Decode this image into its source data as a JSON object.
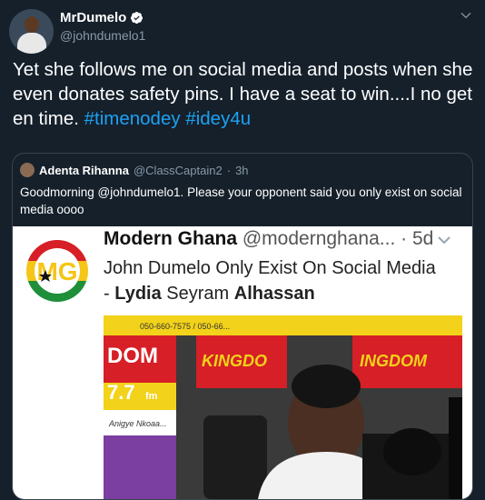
{
  "tweet": {
    "author_name": "MrDumelo",
    "author_handle": "@johndumelo1",
    "text_main": "Yet she follows me on social media and posts when she even donates safety pins. I have a seat to win....I no get en time.",
    "hashtags": [
      "#timenodey",
      "#idey4u"
    ],
    "icons": {
      "verified": "verified-badge-icon",
      "menu": "chevron-down-icon"
    }
  },
  "quote": {
    "author_name": "Adenta Rihanna",
    "author_handle": "@ClassCaptain2",
    "separator": "·",
    "time": "3h",
    "text": "Goodmorning @johndumelo1. Please your opponent said you only exist on social media oooo",
    "image": {
      "logo_text": "MG",
      "account_name": "Modern Ghana",
      "account_handle": "@modernghana...",
      "separator": "·",
      "time": "5d",
      "headline_main": "John Dumelo Only Exist On Social Media",
      "headline_prefix": "- ",
      "headline_name_first": "Lydia",
      "headline_name_mid": " Seyram ",
      "headline_name_last": "Alhassan",
      "banner_phone": "050-660-7575 / 050-66...",
      "banner_left_brand": "DOM",
      "banner_left_freq": "7.7",
      "banner_left_fm": "fm",
      "banner_center_brand": "KINGDO",
      "banner_right_brand": "INGDOM",
      "sign_text": "Anigye Nkoaa..."
    }
  }
}
